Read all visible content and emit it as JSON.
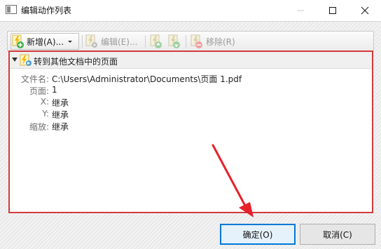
{
  "window": {
    "title": "编辑动作列表"
  },
  "toolbar": {
    "new_label": "新增(A)...",
    "edit_label": "编辑(E)...",
    "remove_label": "移除(R)"
  },
  "group": {
    "title": "转到其他文档中的页面"
  },
  "properties": [
    {
      "key": "文件名:",
      "value": "C:\\Users\\Administrator\\Documents\\页面 1.pdf"
    },
    {
      "key": "页面:",
      "value": "1"
    },
    {
      "key": "X:",
      "value": "继承"
    },
    {
      "key": "Y:",
      "value": "继承"
    },
    {
      "key": "缩放:",
      "value": "继承"
    }
  ],
  "buttons": {
    "ok": "确定(O)",
    "cancel": "取消(C)"
  },
  "colors": {
    "highlight_border": "#d23b3b",
    "annotation_arrow": "#e8202a",
    "ok_focus": "#0078d7"
  }
}
